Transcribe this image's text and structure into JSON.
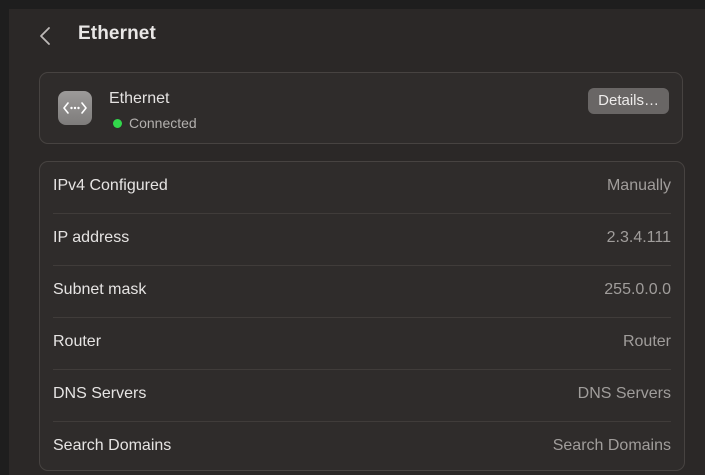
{
  "header": {
    "title": "Ethernet",
    "back_icon": "chevron-left-icon"
  },
  "device": {
    "icon": "ethernet-arrows-icon",
    "name": "Ethernet",
    "status": "Connected",
    "status_color": "#32d74b",
    "details_label": "Details…"
  },
  "info": {
    "rows": [
      {
        "label": "IPv4 Configured",
        "value": "Manually"
      },
      {
        "label": "IP address",
        "value": "2.3.4.111"
      },
      {
        "label": "Subnet mask",
        "value": "255.0.0.0"
      },
      {
        "label": "Router",
        "value": "Router"
      },
      {
        "label": "DNS Servers",
        "value": "DNS Servers"
      },
      {
        "label": "Search Domains",
        "value": "Search Domains"
      }
    ]
  }
}
